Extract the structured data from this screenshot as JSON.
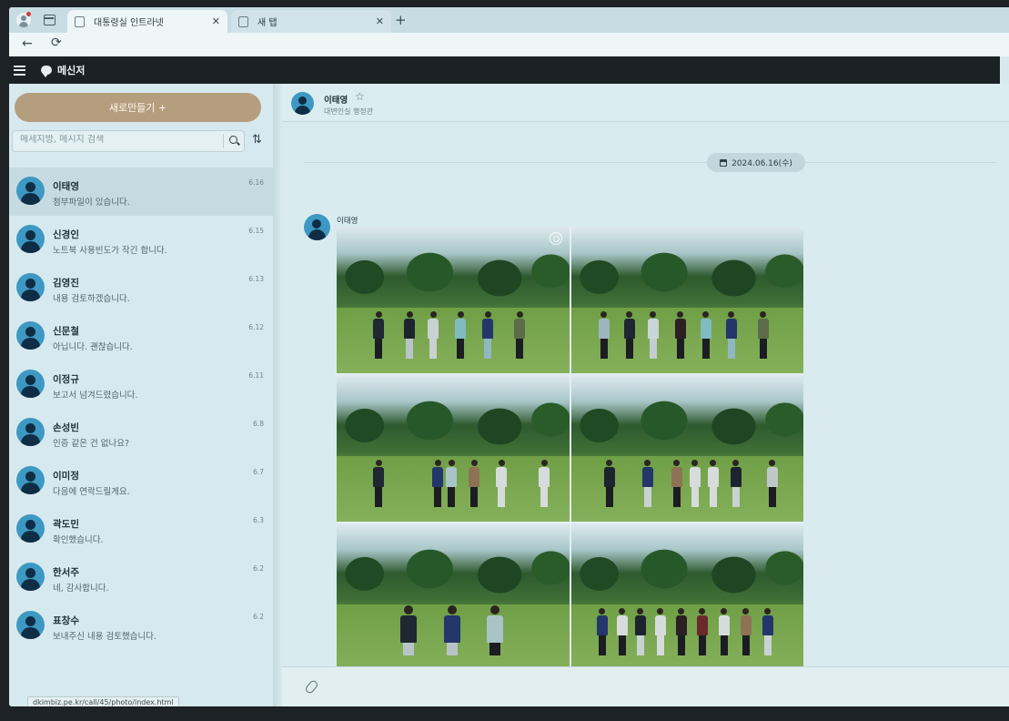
{
  "browser": {
    "tabs": [
      {
        "label": "대통령실 인트라넷",
        "close": "✕"
      },
      {
        "label": "새 탭",
        "close": "✕"
      }
    ],
    "new_tab": "+",
    "back": "←",
    "reload": "⟳",
    "status_url": "dkimbiz.pe.kr/call/45/photo/index.html"
  },
  "app": {
    "title": "메신저"
  },
  "sidebar": {
    "new_button": "새로만들기 +",
    "search_placeholder": "메세지방, 메시지 검색",
    "sort_icon": "⇅",
    "conversations": [
      {
        "name": "이태영",
        "message": "첨부파일이 있습니다.",
        "date": "6.16",
        "selected": true
      },
      {
        "name": "신경인",
        "message": "노트북 사용빈도가 작긴 합니다.",
        "date": "6.15"
      },
      {
        "name": "김영진",
        "message": "내용 검토하겠습니다.",
        "date": "6.13"
      },
      {
        "name": "신문철",
        "message": "아닙니다. 괜찮습니다.",
        "date": "6.12"
      },
      {
        "name": "이정규",
        "message": "보고서 넘겨드렸습니다.",
        "date": "6.11"
      },
      {
        "name": "손성빈",
        "message": "인증 같은 건 없나요?",
        "date": "6.8"
      },
      {
        "name": "이미정",
        "message": "다음에 연락드릴게요.",
        "date": "6.7"
      },
      {
        "name": "곽도민",
        "message": "확인했습니다.",
        "date": "6.3"
      },
      {
        "name": "한서주",
        "message": "네, 감사합니다.",
        "date": "6.2"
      },
      {
        "name": "표창수",
        "message": "보내주신 내용 검토했습니다.",
        "date": "6.2"
      }
    ]
  },
  "chat": {
    "name": "이태영",
    "star_icon": "☆",
    "subtitle": "대변인실 행정관",
    "date_chip": "2024.06.16(수)",
    "sender": "이태영",
    "photos": [
      {
        "name": "group-photo-1"
      },
      {
        "name": "group-photo-2"
      },
      {
        "name": "group-photo-3"
      },
      {
        "name": "group-photo-4"
      },
      {
        "name": "group-photo-5"
      },
      {
        "name": "group-photo-6"
      }
    ]
  },
  "icons": {
    "attach": "paperclip-icon",
    "search": "search-icon",
    "calendar": "calendar-icon"
  },
  "colors": {
    "accent_button": "#b59e7e",
    "header_bg": "#1a2226",
    "avatar": "#3d99c3"
  }
}
